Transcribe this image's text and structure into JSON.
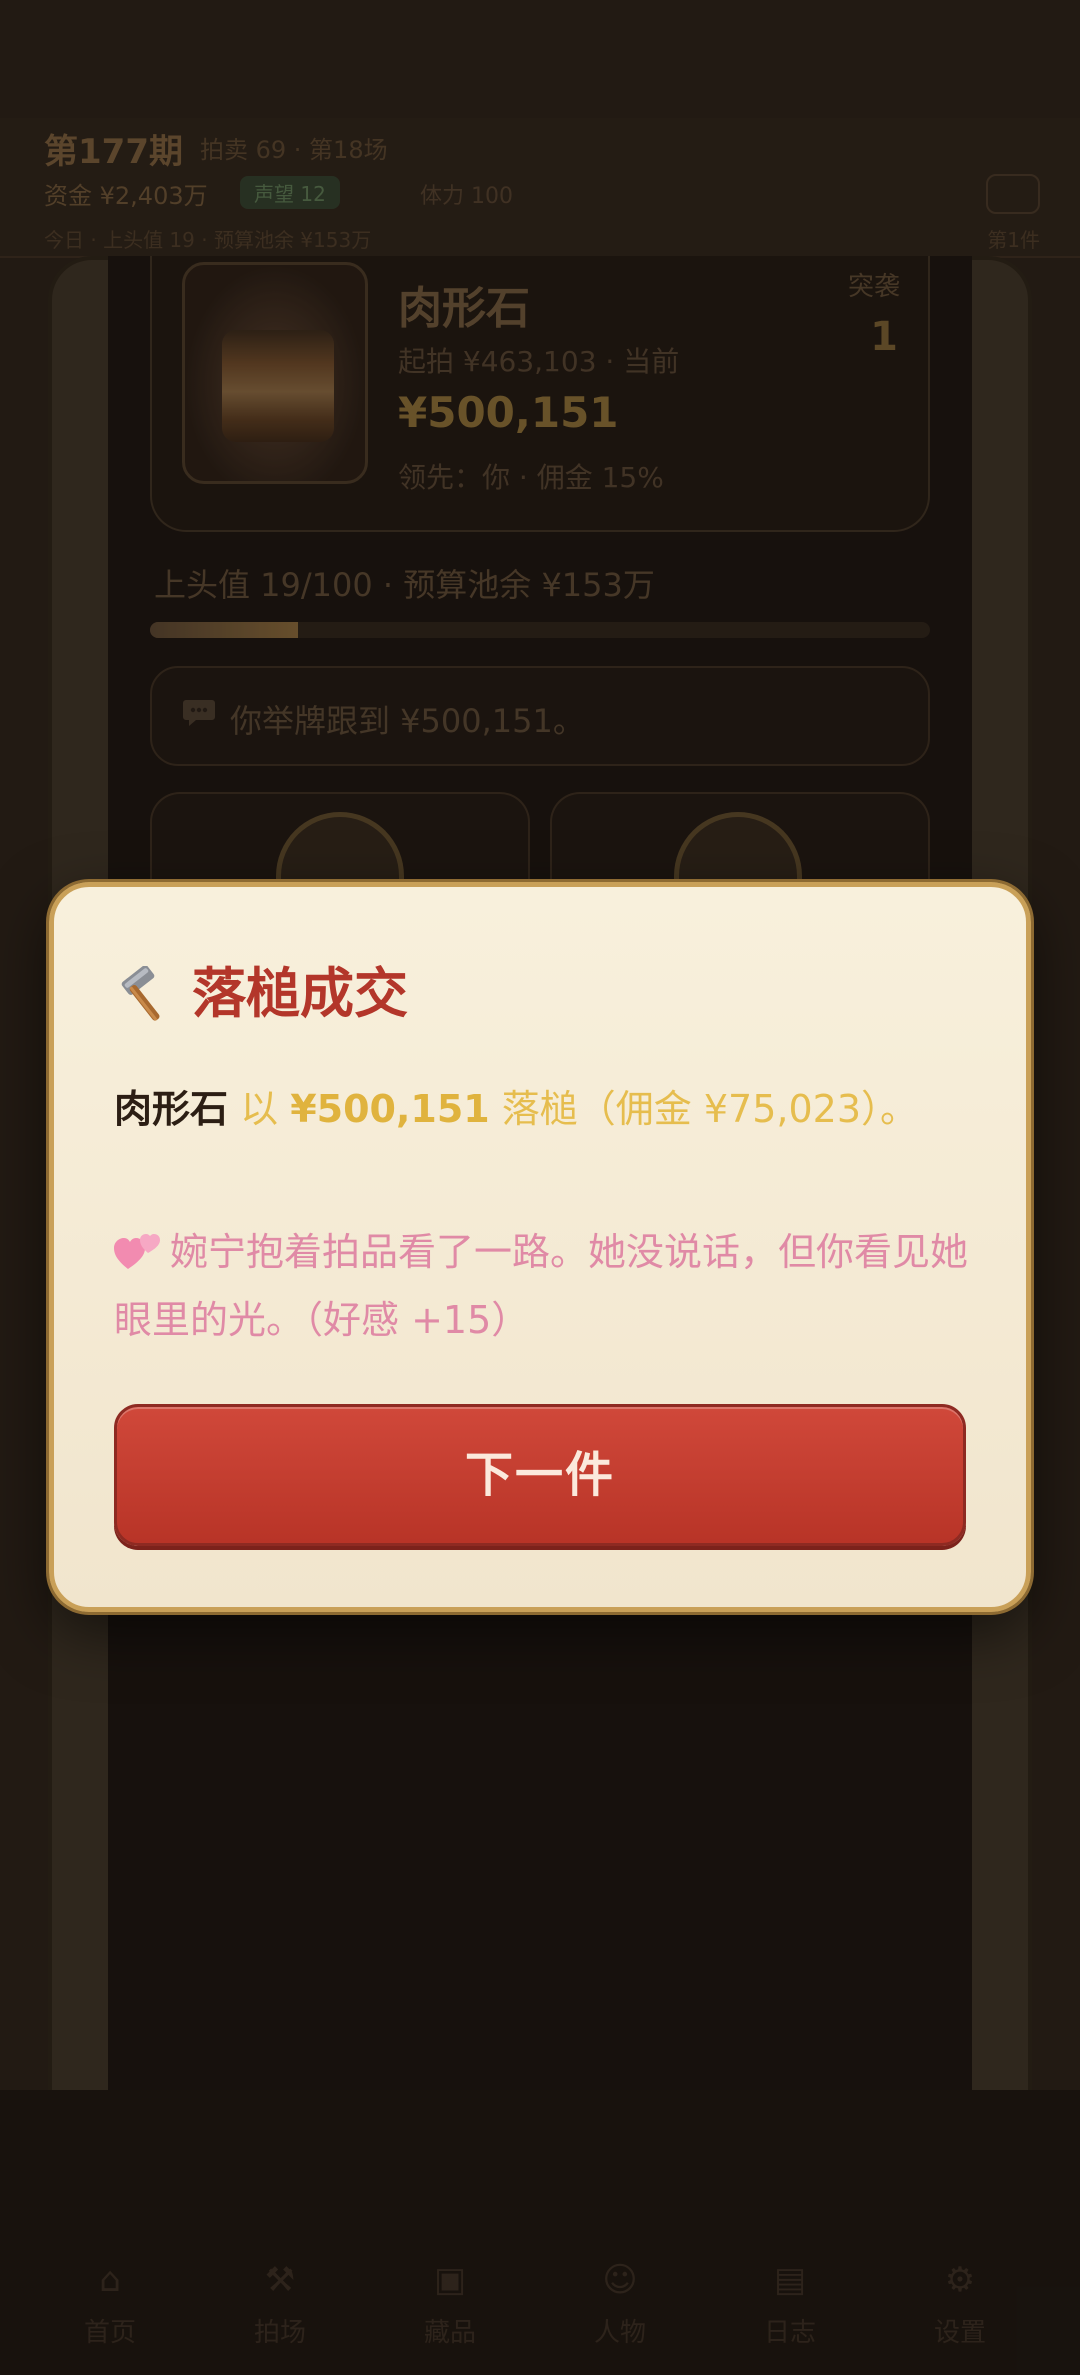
{
  "background": {
    "round_title": "第177期",
    "round_sub": "拍卖 69 · 第18场",
    "money": "资金 ¥2,403万",
    "money_badge": "声望 12",
    "money_extra": "体力 100",
    "info_line": "今日 · 上头值 19 · 预算池余 ¥153万",
    "info_right": "第1件",
    "lot": {
      "name": "肉形石",
      "start": "起拍 ¥463,103 · 当前",
      "price": "¥500,151",
      "lead": "领先：你 · 佣金 15%",
      "tag": "突袭",
      "count": "1"
    },
    "budget_line": "上头值 19/100 · 预算池余 ¥153万",
    "progress_fraction": 0.19,
    "message_icon": "speech-bubble-icon",
    "message": "你举牌跟到 ¥500,151。",
    "tabs": [
      "首页",
      "拍场",
      "藏品",
      "人物",
      "日志",
      "设置"
    ]
  },
  "modal": {
    "icon": "hammer-icon",
    "title": "落槌成交",
    "result": {
      "item": "肉形石",
      "connector": " 以 ",
      "price": "¥500,151",
      "suffix": " 落槌（佣金 ¥75,023）。"
    },
    "affinity_icon": "hearts-icon",
    "affinity_text": "婉宁抱着拍品看了一路。她没说话，但你看见她眼里的光。（好感 +15）",
    "next_button": "下一件"
  },
  "colors": {
    "title_red": "#b3362a",
    "gold": "#e0b33e",
    "pink": "#e08aa6",
    "button_red": "#c43d30",
    "modal_bg": "#f6eedb"
  }
}
